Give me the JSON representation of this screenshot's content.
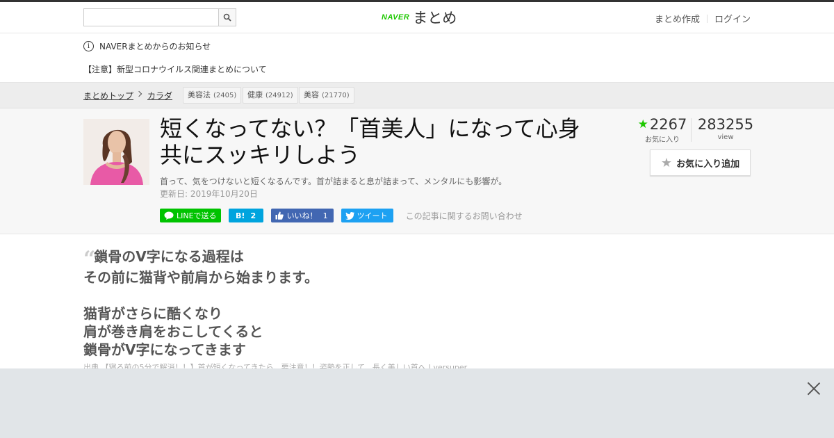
{
  "header": {
    "search": {
      "placeholder": "",
      "value": "",
      "icon": "search-icon"
    },
    "logo": {
      "naver": "NAVER",
      "matome": "まとめ",
      "naver_color": "#1ec800"
    },
    "links": [
      "まとめ作成",
      "ログイン"
    ]
  },
  "notice": {
    "title": "NAVERまとめからのお知らせ",
    "icon_glyph": "i",
    "link": "【注意】新型コロナウイルス関連まとめについて"
  },
  "breadcrumb": {
    "items": [
      "まとめトップ",
      "カラダ"
    ],
    "tags": [
      {
        "label": "美容法",
        "count": "(2405)"
      },
      {
        "label": "健康",
        "count": "(24912)"
      },
      {
        "label": "美容",
        "count": "(21770)"
      }
    ]
  },
  "article": {
    "title": "短くなってない？「首美人」になって心身共にスッキリしよう",
    "description": "首って、気をつけないと短くなるんです。首が詰まると息が詰まって、メンタルにも影響が。",
    "updated": "更新日: 2019年10月20日",
    "share": {
      "line": "LINEで送る",
      "hatena": "B!",
      "hatena_count": "2",
      "facebook": "いいね！",
      "facebook_count": "1",
      "twitter": "ツイート"
    },
    "inquiry": "この記事に関するお問い合わせ",
    "stats": {
      "favorites": "2267",
      "favorites_label": "お気に入り",
      "views": "283255",
      "views_label": "view"
    },
    "favorite_button": "お気に入り追加"
  },
  "content": {
    "quote_mark": "“",
    "quote_lines": [
      "鎖骨のV字になる過程は",
      "その前に猫背や前肩から始まります。",
      "",
      "猫背がさらに酷くなり",
      "肩が巻き肩をおこしてくると",
      "鎖骨がV字になってきます"
    ],
    "source": "出典 【寝る前の5分で解消！！】首が短くなってきたら、要注意！！姿勢を正して、長く美しい首へ | versuper"
  },
  "colors": {
    "accent_green": "#1ec800",
    "line": "#00c300",
    "hatena": "#00a4de",
    "facebook": "#4267b2",
    "twitter": "#1da1f2"
  }
}
